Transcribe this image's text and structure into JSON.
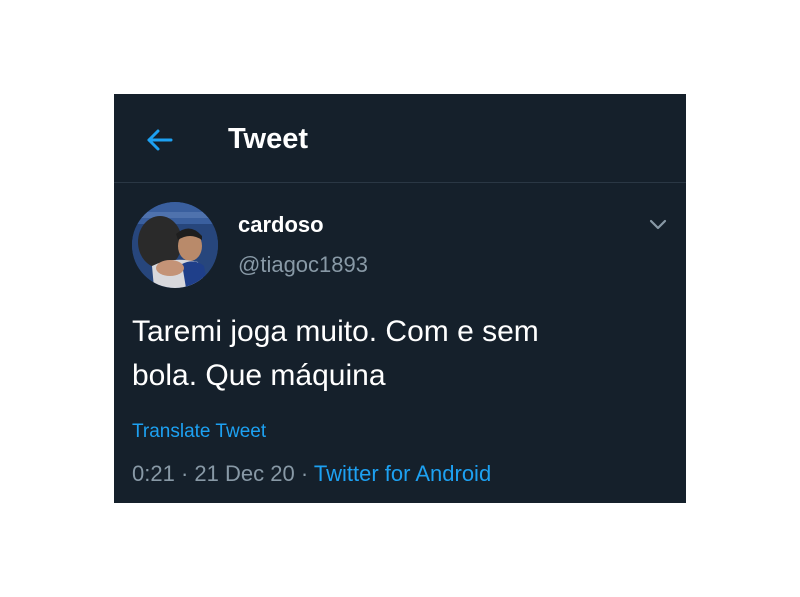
{
  "header": {
    "title": "Tweet",
    "back_icon": "arrow-left-icon"
  },
  "tweet": {
    "author": {
      "display_name": "cardoso",
      "handle": "@tiagoc1893",
      "avatar_icon": "user-avatar"
    },
    "more_icon": "chevron-down-icon",
    "text": "Taremi joga muito. Com e sem\nbola. Que máquina",
    "translate_label": "Translate Tweet",
    "meta": {
      "time": "0:21",
      "separator": "·",
      "date": "21 Dec 20",
      "source": "Twitter for Android"
    }
  },
  "colors": {
    "background": "#15202b",
    "accent": "#1da1f2",
    "secondary_text": "#8899a6",
    "primary_text": "#ffffff",
    "divider": "#2a3744"
  }
}
